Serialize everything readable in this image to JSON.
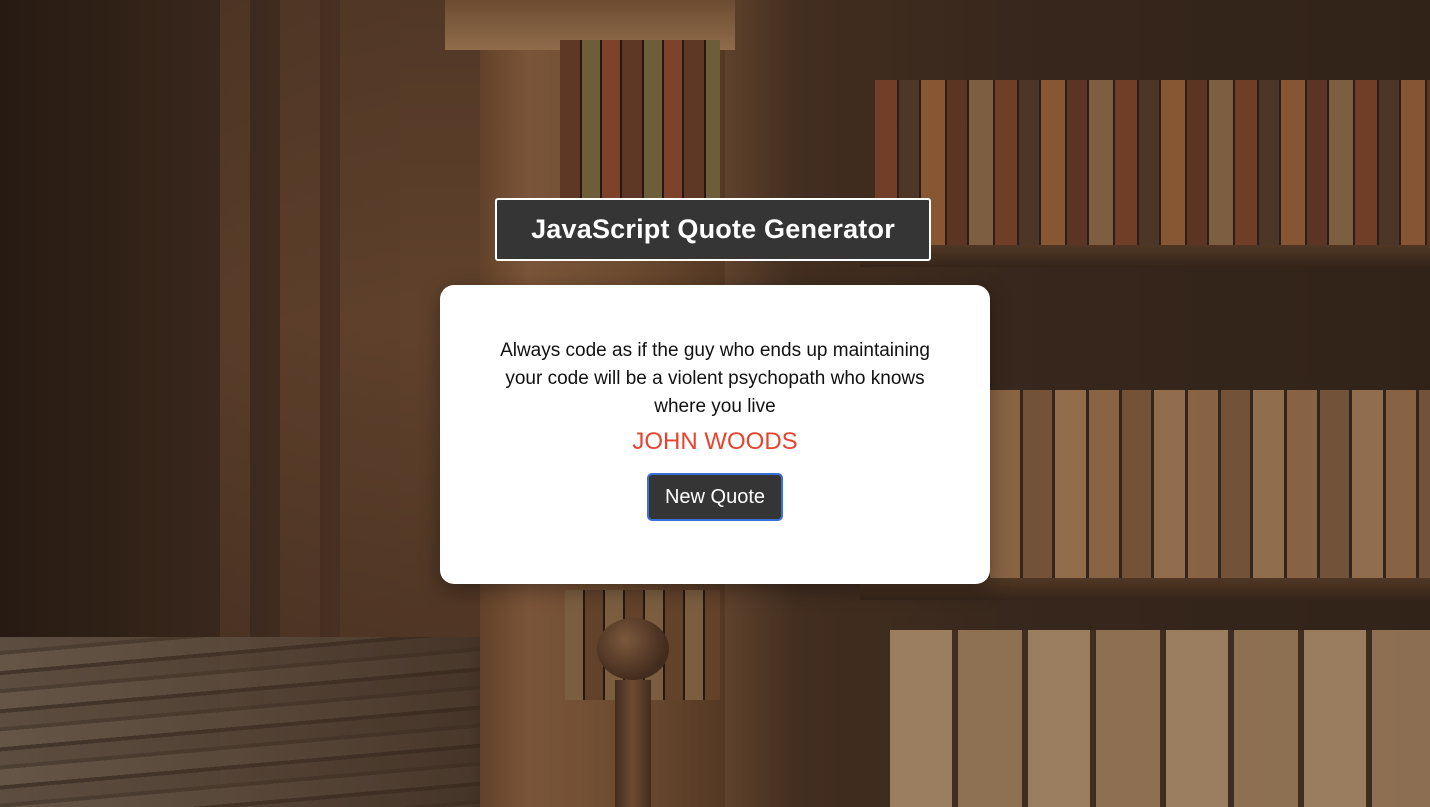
{
  "header": {
    "title": "JavaScript Quote Generator"
  },
  "quote": {
    "text": "Always code as if the guy who ends up maintaining your code will be a violent psychopath who knows where you live",
    "author": "JOHN WOODS"
  },
  "actions": {
    "new_quote_label": "New Quote"
  },
  "colors": {
    "title_background": "#353535",
    "card_background": "#ffffff",
    "author_color": "#e8432e",
    "button_background": "#353535",
    "button_border": "#3a6fd6"
  },
  "background": {
    "image": "library-bookshelves"
  }
}
